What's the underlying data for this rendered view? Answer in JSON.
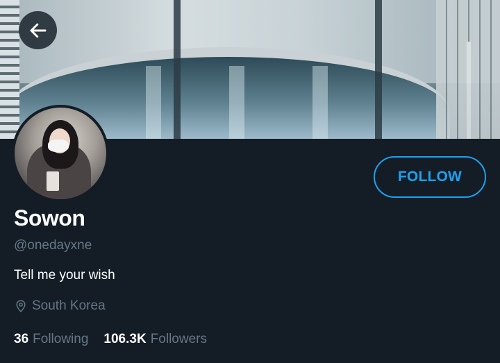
{
  "profile": {
    "name": "Sowon",
    "handle": "@onedayxne",
    "bio": "Tell me your wish",
    "location": "South Korea"
  },
  "actions": {
    "follow_label": "FOLLOW"
  },
  "stats": {
    "following_count": "36",
    "following_label": "Following",
    "followers_count": "106.3K",
    "followers_label": "Followers"
  },
  "icons": {
    "back": "back-arrow-icon",
    "location": "location-pin-icon"
  },
  "colors": {
    "background": "#141d26",
    "accent": "#1da1f2",
    "muted_text": "#657786"
  }
}
